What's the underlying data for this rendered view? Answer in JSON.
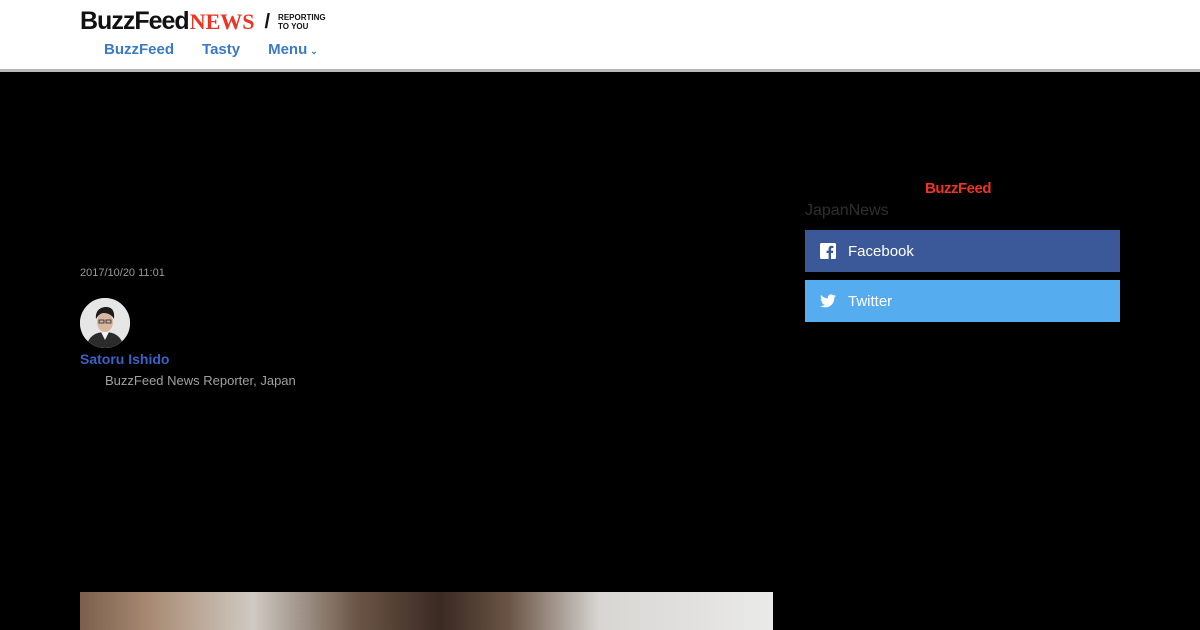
{
  "header": {
    "logo": {
      "brand": "BuzzFeed",
      "news": "NEWS",
      "slash": "/",
      "tagline_line1": "REPORTING",
      "tagline_line2": "TO YOU"
    },
    "nav": [
      {
        "label": "BuzzFeed"
      },
      {
        "label": "Tasty"
      },
      {
        "label": "Menu"
      }
    ]
  },
  "article": {
    "date": "2017/10/20 11:01",
    "author": {
      "name": "Satoru Ishido",
      "title": "BuzzFeed News Reporter, Japan"
    }
  },
  "sidebar": {
    "brand": "BuzzFeed",
    "subtitle": "JapanNews",
    "share": [
      {
        "label": "Facebook",
        "icon": "facebook-icon",
        "color": "#3b5998"
      },
      {
        "label": "Twitter",
        "icon": "twitter-icon",
        "color": "#55acee"
      }
    ]
  },
  "colors": {
    "accent_red": "#ee3322",
    "link_blue": "#3a7ac7",
    "author_blue": "#3a62c6"
  }
}
